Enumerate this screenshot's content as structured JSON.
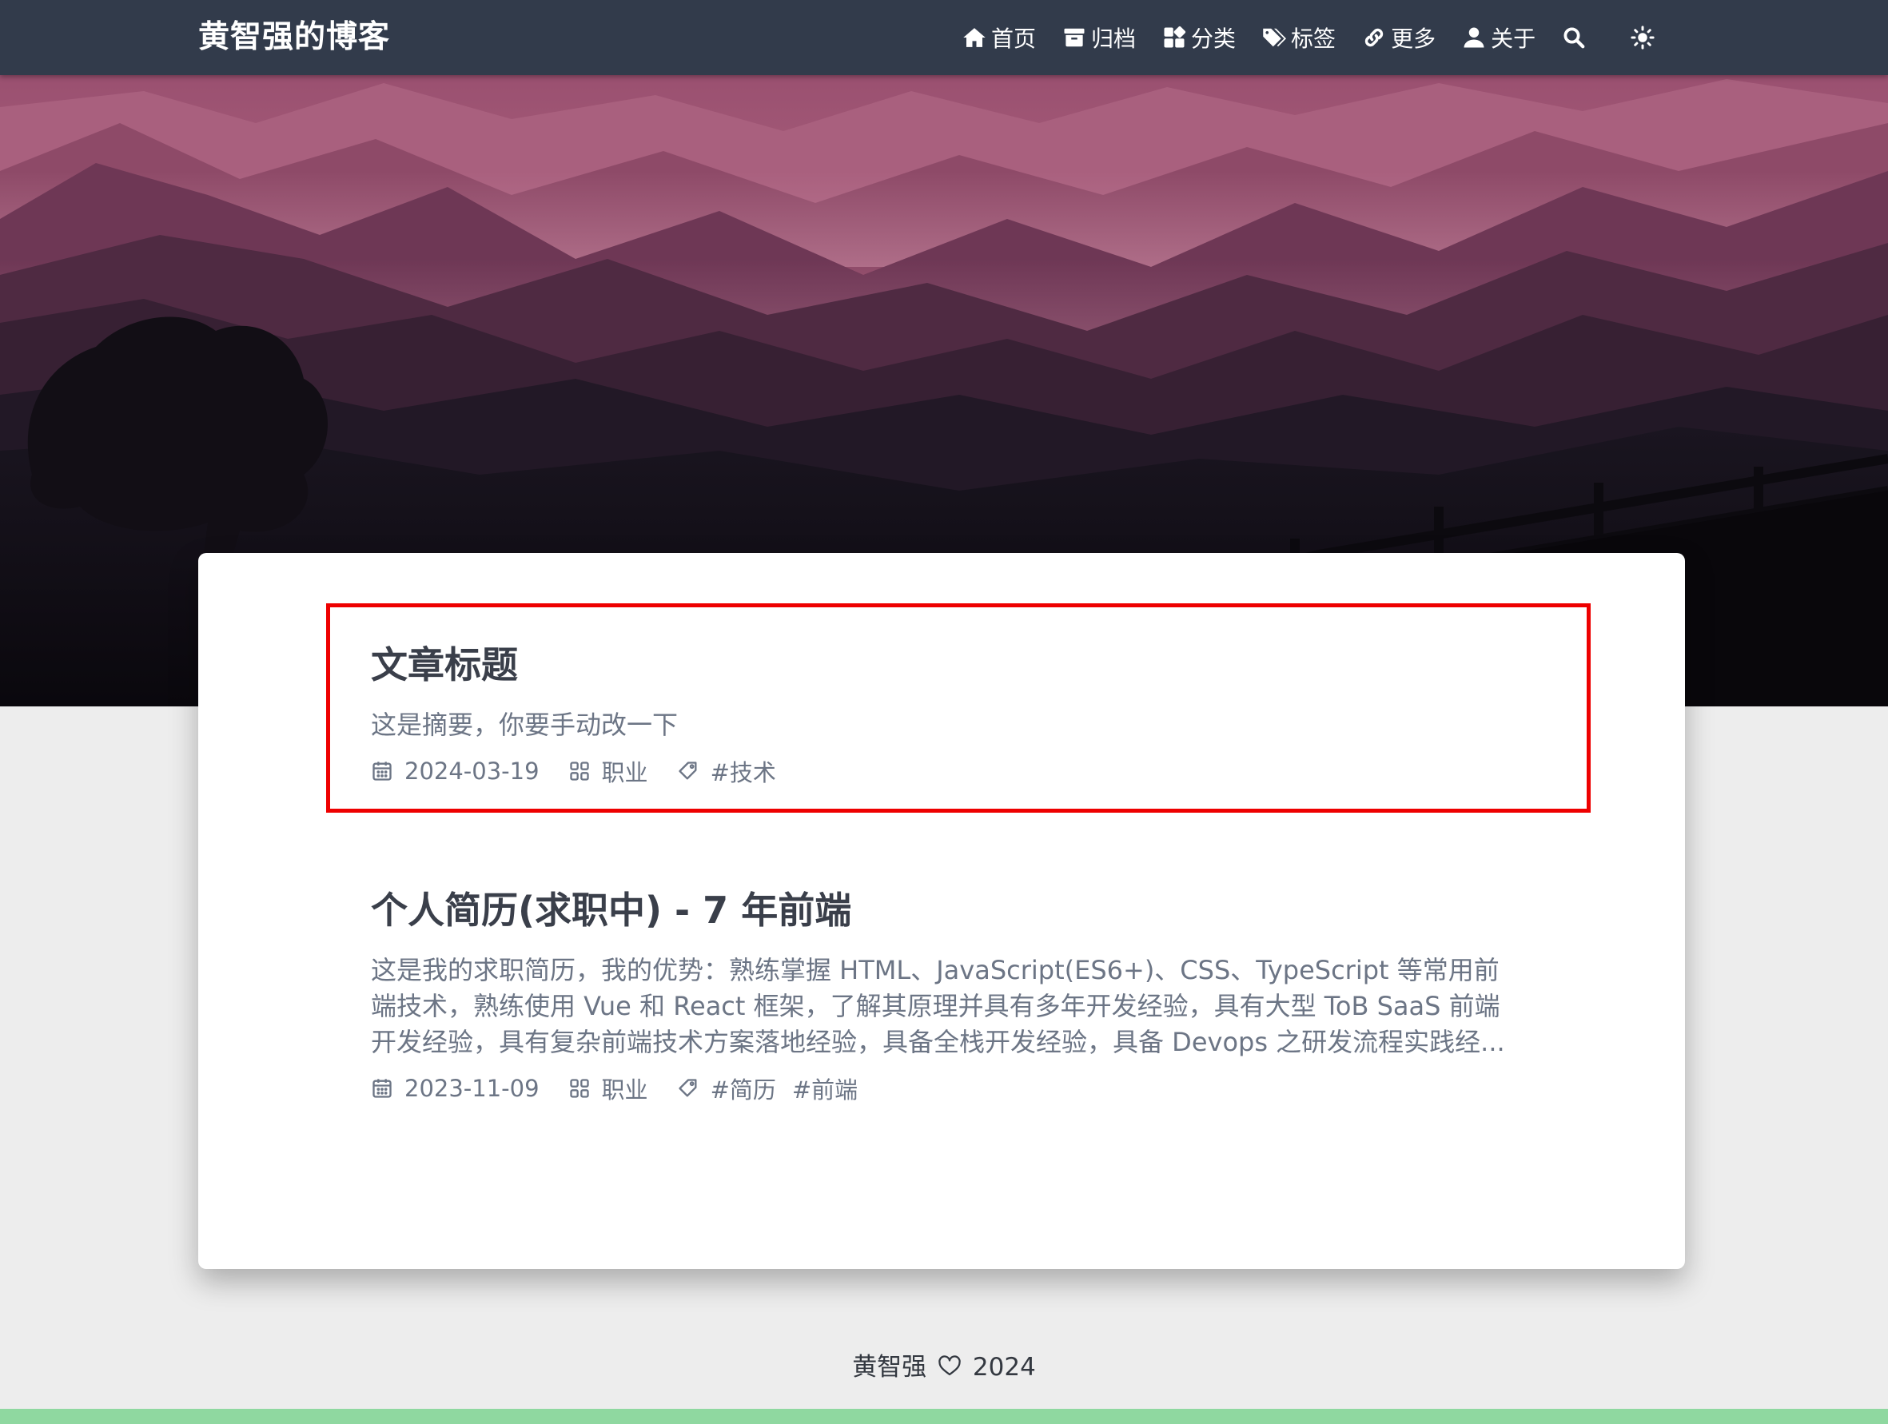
{
  "site": {
    "brand": "黄智强的博客"
  },
  "nav": {
    "items": [
      {
        "label": "首页",
        "icon": "home-icon"
      },
      {
        "label": "归档",
        "icon": "archive-icon"
      },
      {
        "label": "分类",
        "icon": "categories-icon"
      },
      {
        "label": "标签",
        "icon": "tags-icon"
      },
      {
        "label": "更多",
        "icon": "link-icon"
      },
      {
        "label": "关于",
        "icon": "user-icon"
      }
    ],
    "search_icon": "search-icon",
    "theme_icon": "sun-icon"
  },
  "posts": [
    {
      "title": "文章标题",
      "summary": "这是摘要，你要手动改一下",
      "date": "2024-03-19",
      "category": "职业",
      "tags": [
        "#技术"
      ]
    },
    {
      "title": "个人简历(求职中) - 7 年前端",
      "summary": "这是我的求职简历，我的优势：熟练掌握 HTML、JavaScript(ES6+)、CSS、TypeScript 等常用前端技术，熟练使用 Vue 和 React 框架，了解其原理并具有多年开发经验，具有大型 ToB SaaS 前端开发经验，具有复杂前端技术方案落地经验，具备全栈开发经验，具备 Devops 之研发流程实践经...",
      "date": "2023-11-09",
      "category": "职业",
      "tags": [
        "#简历",
        "#前端"
      ]
    }
  ],
  "footer": {
    "author": "黄智强",
    "year": "2024"
  },
  "colors": {
    "navbar": "#323b4b",
    "highlight": "#ee0000",
    "meta_text": "#6c7585",
    "bottom_strip": "#8fd8a0"
  }
}
